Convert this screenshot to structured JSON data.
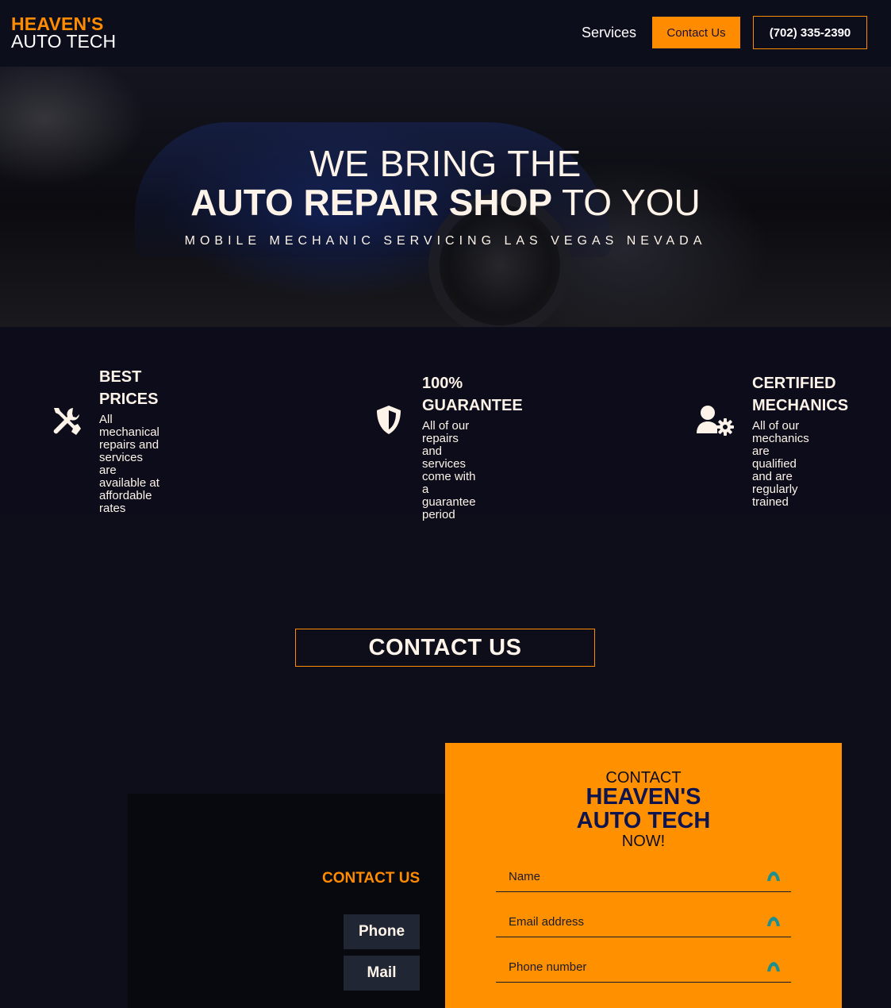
{
  "header": {
    "logo_top": "HEAVEN'S",
    "logo_bottom": "AUTO TECH",
    "nav_services": "Services",
    "contact_button": "Contact Us",
    "phone_button": "(702) 335-2390"
  },
  "hero": {
    "line1": "WE BRING THE",
    "line2_bold": "AUTO REPAIR SHOP",
    "line2_thin": " TO YOU",
    "subtitle": "MOBILE MECHANIC SERVICING LAS VEGAS NEVADA"
  },
  "features": [
    {
      "title_1": "BEST",
      "title_2": "PRICES",
      "desc_1": "All mechanical",
      "desc_2": "repairs and",
      "desc_3": "services are",
      "desc_4": "available at",
      "desc_5": "affordable rates",
      "icon": "tools-icon"
    },
    {
      "title_1": "100%",
      "title_2": "GUARANTEE",
      "desc_1": "All of our repairs",
      "desc_2": "and services",
      "desc_3": "come with a",
      "desc_4": "guarantee period",
      "icon": "shield-icon"
    },
    {
      "title_1": "CERTIFIED",
      "title_2": "MECHANICS",
      "desc_1": "All of our",
      "desc_2": "mechanics are",
      "desc_3": "qualified and are",
      "desc_4": "regularly trained",
      "icon": "user-gear-icon"
    }
  ],
  "contact_banner": "CONTACT US",
  "left_panel": {
    "title": "CONTACT US",
    "phone_button": "Phone",
    "mail_button": "Mail"
  },
  "form": {
    "pre": "CONTACT",
    "brand_1": "HEAVEN'S",
    "brand_2": "AUTO TECH",
    "post": "NOW!",
    "name_placeholder": "Name",
    "email_placeholder": "Email address",
    "phone_placeholder": "Phone number"
  },
  "colors": {
    "accent": "#ff8c00",
    "background": "#0d0e1a",
    "form_background": "#ff9100",
    "brand_navy": "#0d1450"
  }
}
